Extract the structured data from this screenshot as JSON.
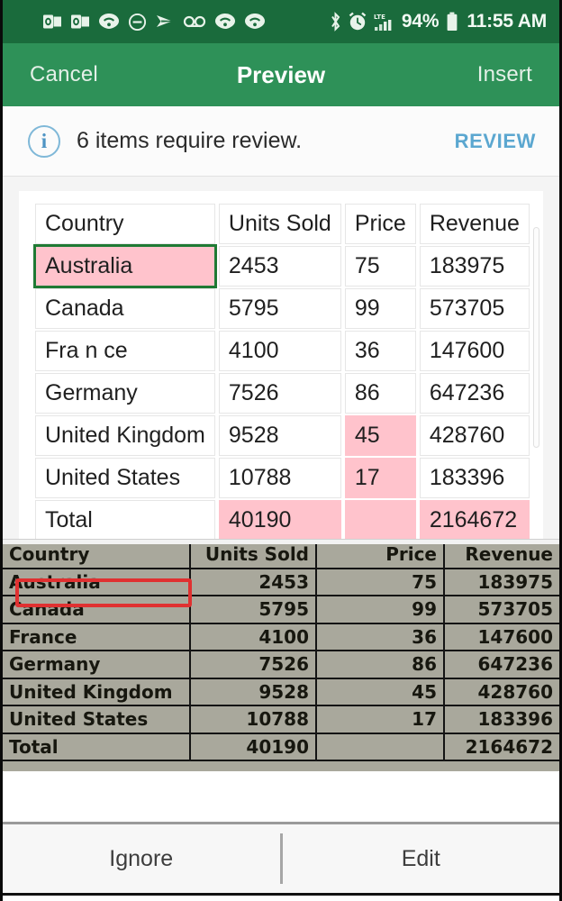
{
  "status_bar": {
    "icons": [
      "outlook-icon",
      "outlook-icon",
      "wifi-call-icon",
      "do-not-disturb-icon",
      "yammer-icon",
      "voicemail-icon",
      "wifi-call-icon",
      "wifi-call-icon"
    ],
    "right_icons": [
      "bluetooth-icon",
      "alarm-icon",
      "lte-signal-icon",
      "battery-icon"
    ],
    "battery_percent": "94%",
    "network": "LTE",
    "time": "11:55 AM"
  },
  "app_bar": {
    "cancel_label": "Cancel",
    "title": "Preview",
    "insert_label": "Insert"
  },
  "banner": {
    "icon": "info-icon",
    "glyph": "i",
    "message": "6 items require review.",
    "action_label": "REVIEW",
    "action_color": "#5ba7d0"
  },
  "table": {
    "columns": [
      "Country",
      "Units Sold",
      "Price",
      "Revenue"
    ],
    "rows": [
      {
        "country": "Australia",
        "units": "2453",
        "price": "75",
        "revenue": "183975"
      },
      {
        "country": "Canada",
        "units": "5795",
        "price": "99",
        "revenue": "573705"
      },
      {
        "country": "Fra n ce",
        "units": "4100",
        "price": "36",
        "revenue": "147600"
      },
      {
        "country": "Germany",
        "units": "7526",
        "price": "86",
        "revenue": "647236"
      },
      {
        "country": "United Kingdom",
        "units": "9528",
        "price": "45",
        "revenue": "428760"
      },
      {
        "country": "United States",
        "units": "10788",
        "price": "17",
        "revenue": "183396"
      },
      {
        "country": "Total",
        "units": "40190",
        "price": "",
        "revenue": "2164672"
      }
    ],
    "flagged_cells": [
      "r0.country",
      "r4.price",
      "r5.price",
      "r6.units",
      "r6.price",
      "r6.revenue"
    ],
    "selected_cell": "r0.country",
    "flag_color": "#ffc3cc",
    "selection_color": "#1f7a34"
  },
  "photo_preview": {
    "columns": [
      "Country",
      "Units Sold",
      "Price",
      "Revenue"
    ],
    "rows": [
      {
        "country": "Australia",
        "units": "2453",
        "price": "75",
        "revenue": "183975"
      },
      {
        "country": "Canada",
        "units": "5795",
        "price": "99",
        "revenue": "573705"
      },
      {
        "country": "France",
        "units": "4100",
        "price": "36",
        "revenue": "147600"
      },
      {
        "country": "Germany",
        "units": "7526",
        "price": "86",
        "revenue": "647236"
      },
      {
        "country": "United Kingdom",
        "units": "9528",
        "price": "45",
        "revenue": "428760"
      },
      {
        "country": "United States",
        "units": "10788",
        "price": "17",
        "revenue": "183396"
      },
      {
        "country": "Total",
        "units": "40190",
        "price": "",
        "revenue": "2164672"
      }
    ],
    "highlight_cell": "Australia",
    "highlight_color": "#e03131"
  },
  "bottom_bar": {
    "ignore_label": "Ignore",
    "edit_label": "Edit"
  },
  "theme": {
    "status_bar_green": "#1a6b3c",
    "app_bar_green": "#2e9158"
  }
}
